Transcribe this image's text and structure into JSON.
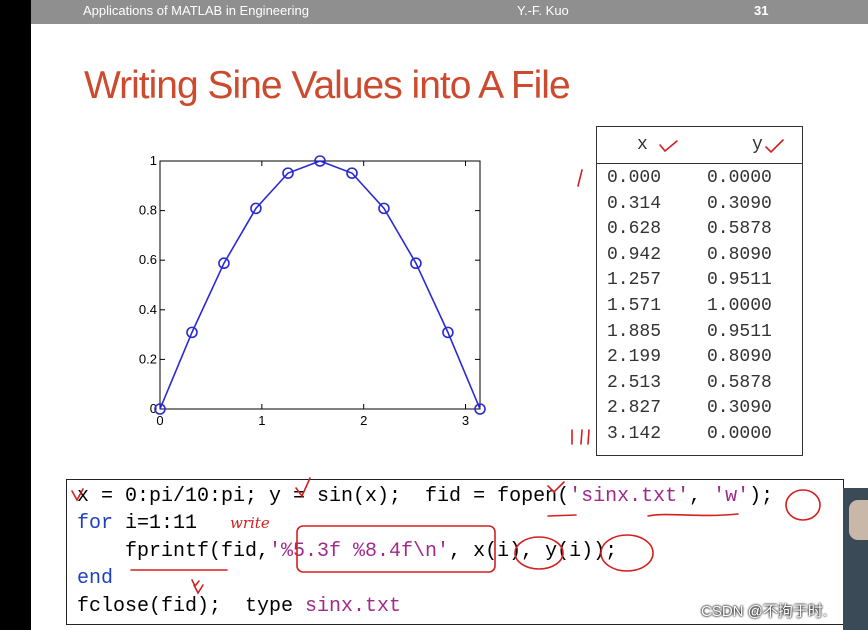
{
  "header": {
    "course": "Applications of MATLAB in Engineering",
    "author": "Y.-F. Kuo",
    "page": "31"
  },
  "slide": {
    "title": "Writing Sine Values into A File"
  },
  "chart_data": {
    "type": "line",
    "x": [
      0,
      0.314,
      0.628,
      0.942,
      1.257,
      1.571,
      1.885,
      2.199,
      2.513,
      2.827,
      3.142
    ],
    "y": [
      0,
      0.309,
      0.5878,
      0.809,
      0.9511,
      1.0,
      0.9511,
      0.809,
      0.5878,
      0.309,
      0
    ],
    "marker": "circle",
    "line_color": "#2a2ad4",
    "xlim": [
      0,
      3.142
    ],
    "ylim": [
      0,
      1
    ],
    "xticks": [
      "0",
      "1",
      "2",
      "3"
    ],
    "yticks": [
      "0",
      "0.2",
      "0.4",
      "0.6",
      "0.8",
      "1"
    ],
    "grid": false
  },
  "table": {
    "columns": [
      "x",
      "y"
    ],
    "rows": [
      [
        "0.000",
        "0.0000"
      ],
      [
        "0.314",
        "0.3090"
      ],
      [
        "0.628",
        "0.5878"
      ],
      [
        "0.942",
        "0.8090"
      ],
      [
        "1.257",
        "0.9511"
      ],
      [
        "1.571",
        "1.0000"
      ],
      [
        "1.885",
        "0.9511"
      ],
      [
        "2.199",
        "0.8090"
      ],
      [
        "2.513",
        "0.5878"
      ],
      [
        "2.827",
        "0.3090"
      ],
      [
        "3.142",
        "0.0000"
      ]
    ]
  },
  "code": {
    "l1_a": "x = 0:pi/10:pi; y = sin(x);  fid = fopen(",
    "l1_str1": "'sinx.txt'",
    "l1_b": ", ",
    "l1_str2": "'w'",
    "l1_c": ");",
    "l2_kw": "for",
    "l2_rest": " i=1:11",
    "l3_a": "    fprintf(fid,",
    "l3_str": "'%5.3f %8.4f\\n'",
    "l3_b": ", x(i), y(i));",
    "l4_kw": "end",
    "l5_a": "fclose(fid);  type ",
    "l5_str": "sinx.txt"
  },
  "annotation": {
    "handwriting": "write",
    "ink_color": "#d42020"
  },
  "watermark": "CSDN @不拘于时."
}
